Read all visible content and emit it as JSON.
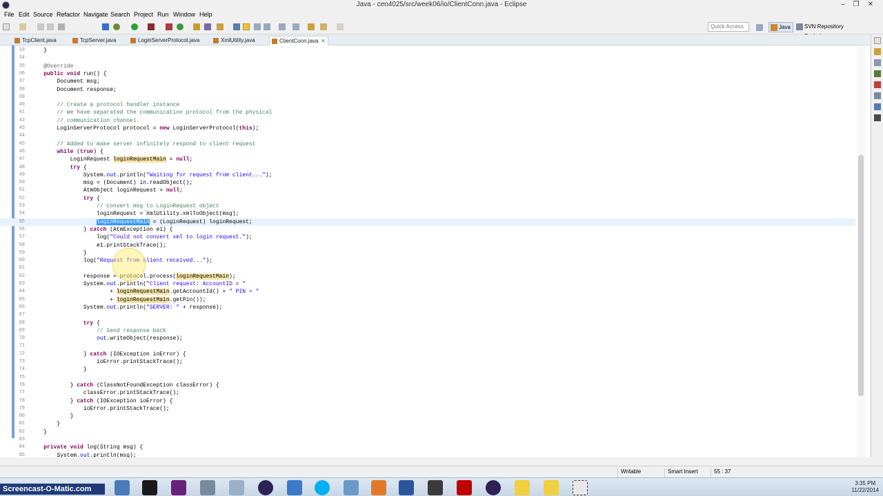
{
  "window": {
    "title": "Java - cen4025/src/week06/io/ClientConn.java - Eclipse"
  },
  "menu": [
    "File",
    "Edit",
    "Source",
    "Refactor",
    "Navigate",
    "Search",
    "Project",
    "Run",
    "Window",
    "Help"
  ],
  "toolbar": {
    "quick_access_placeholder": "Quick Access"
  },
  "perspectives": [
    "Java",
    "SVN Repository Exploring"
  ],
  "tabs": [
    {
      "label": "TcpClient.java",
      "active": false
    },
    {
      "label": "TcpServer.java",
      "active": false
    },
    {
      "label": "LoginServerProtocol.java",
      "active": false
    },
    {
      "label": "XmlUtility.java",
      "active": false
    },
    {
      "label": "ClientConn.java",
      "active": true
    }
  ],
  "editor": {
    "current_line": 55,
    "lines": [
      {
        "n": "33",
        "t": "    }"
      },
      {
        "n": "34",
        "t": ""
      },
      {
        "n": "35",
        "t": "    @Override"
      },
      {
        "n": "36",
        "t": "    public void run() {"
      },
      {
        "n": "37",
        "t": "        Document msg;"
      },
      {
        "n": "38",
        "t": "        Document response;"
      },
      {
        "n": "39",
        "t": ""
      },
      {
        "n": "40",
        "t": "        // Create a protocol handler instance"
      },
      {
        "n": "41",
        "t": "        // We have separated the communication protocol from the physical"
      },
      {
        "n": "42",
        "t": "        // communication channel."
      },
      {
        "n": "43",
        "t": "        LoginServerProtocol protocol = new LoginServerProtocol(this);"
      },
      {
        "n": "44",
        "t": ""
      },
      {
        "n": "45",
        "t": "        // Added to make server infinitely respond to client request"
      },
      {
        "n": "46",
        "t": "        while (true) {"
      },
      {
        "n": "47",
        "t": "            LoginRequest loginRequestMain = null;"
      },
      {
        "n": "48",
        "t": "            try {"
      },
      {
        "n": "49",
        "t": "                System.out.println(\"Waiting for request from client...\");"
      },
      {
        "n": "50",
        "t": "                msg = (Document) in.readObject();"
      },
      {
        "n": "51",
        "t": "                AtmObject loginRequest = null;"
      },
      {
        "n": "52",
        "t": "                try {"
      },
      {
        "n": "53",
        "t": "                    // convert msg to LoginRequest object"
      },
      {
        "n": "54",
        "t": "                    loginRequest = XmlUtility.xmlToObject(msg);"
      },
      {
        "n": "55",
        "t": "                    loginRequestMain = (LoginRequest) loginRequest;"
      },
      {
        "n": "56",
        "t": "                } catch (AtmException e1) {"
      },
      {
        "n": "57",
        "t": "                    log(\"Could not convert xml to login request.\");"
      },
      {
        "n": "58",
        "t": "                    e1.printStackTrace();"
      },
      {
        "n": "59",
        "t": "                }"
      },
      {
        "n": "60",
        "t": "                log(\"Request from client received...\");"
      },
      {
        "n": "61",
        "t": ""
      },
      {
        "n": "62",
        "t": "                response = protocol.process(loginRequestMain);"
      },
      {
        "n": "63",
        "t": "                System.out.println(\"Client request: AccountID = \""
      },
      {
        "n": "64",
        "t": "                        + loginRequestMain.getAccountId() + \" PIN = \""
      },
      {
        "n": "65",
        "t": "                        + loginRequestMain.getPin());"
      },
      {
        "n": "66",
        "t": "                System.out.println(\"SERVER: \" + response);"
      },
      {
        "n": "67",
        "t": ""
      },
      {
        "n": "68",
        "t": "                try {"
      },
      {
        "n": "69",
        "t": "                    // Send response back"
      },
      {
        "n": "70",
        "t": "                    out.writeObject(response);"
      },
      {
        "n": "71",
        "t": ""
      },
      {
        "n": "72",
        "t": "                } catch (IOException ioError) {"
      },
      {
        "n": "73",
        "t": "                    ioError.printStackTrace();"
      },
      {
        "n": "74",
        "t": "                }"
      },
      {
        "n": "75",
        "t": ""
      },
      {
        "n": "76",
        "t": "            } catch (ClassNotFoundException classError) {"
      },
      {
        "n": "77",
        "t": "                classError.printStackTrace();"
      },
      {
        "n": "78",
        "t": "            } catch (IOException ioError) {"
      },
      {
        "n": "79",
        "t": "                ioError.printStackTrace();"
      },
      {
        "n": "80",
        "t": "            }"
      },
      {
        "n": "81",
        "t": "        }"
      },
      {
        "n": "82",
        "t": "    }"
      },
      {
        "n": "83",
        "t": ""
      },
      {
        "n": "84",
        "t": "    private void log(String msg) {"
      },
      {
        "n": "85",
        "t": "        System.out.println(msg);"
      }
    ]
  },
  "status": {
    "mode": "Writable",
    "insert": "Smart Insert",
    "position": "55 : 37"
  },
  "taskbar": {
    "watermark": "Screencast-O-Matic.com",
    "time": "3:35 PM",
    "date": "11/22/2014"
  },
  "colors": {
    "keyword": "#7f0055",
    "comment": "#3f7f5f",
    "string": "#2a00ff",
    "selection": "#3399ff",
    "occurrence": "#f5e4a6"
  }
}
